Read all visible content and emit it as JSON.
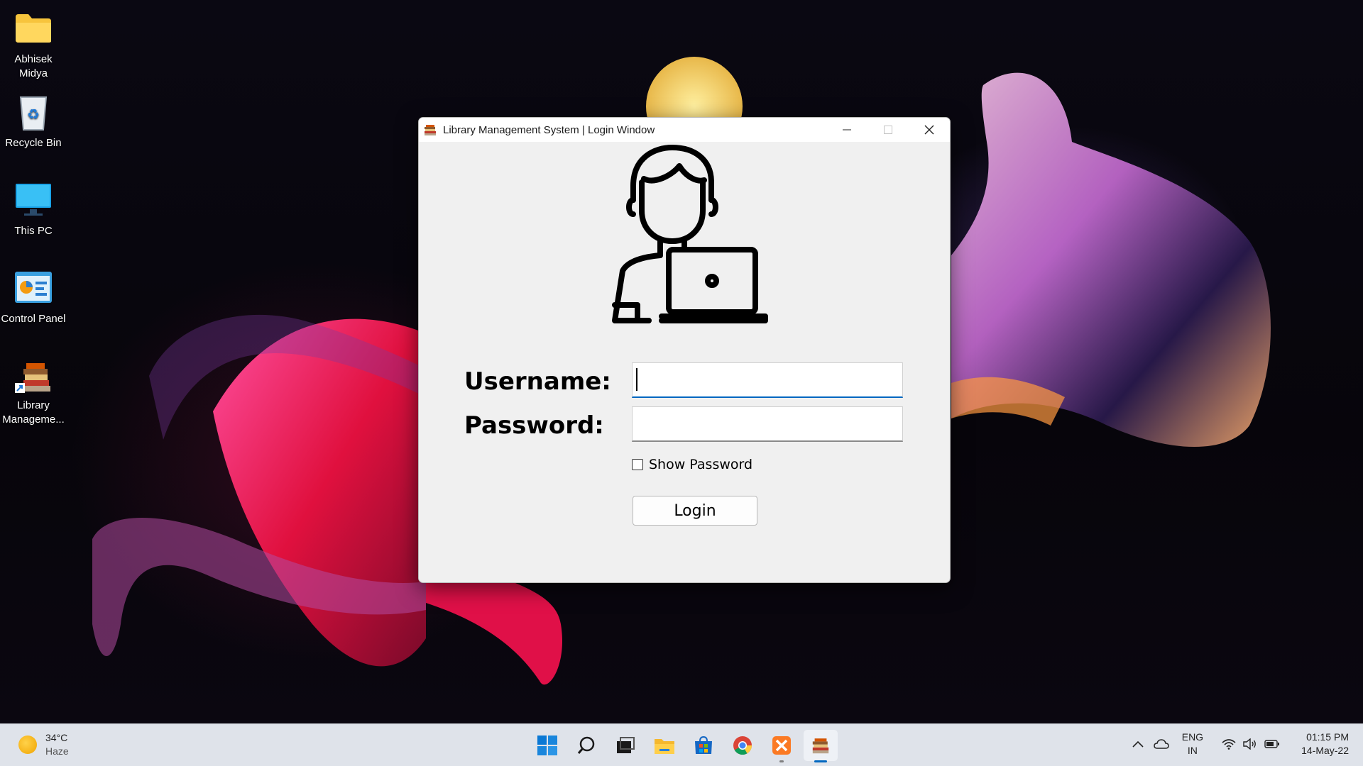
{
  "desktop": {
    "icons": [
      {
        "label": "Abhisek\nMidya",
        "icon": "folder-icon"
      },
      {
        "label": "Recycle Bin",
        "icon": "recycle-bin-icon"
      },
      {
        "label": "This PC",
        "icon": "monitor-icon"
      },
      {
        "label": "Control Panel",
        "icon": "control-panel-icon"
      },
      {
        "label": "Library\nManageme...",
        "icon": "library-shortcut-icon"
      }
    ]
  },
  "window": {
    "title": "Library Management System | Login Window",
    "username_label": "Username:",
    "password_label": "Password:",
    "username_value": "",
    "password_value": "",
    "show_password_label": "Show Password",
    "show_password_checked": false,
    "login_label": "Login"
  },
  "taskbar": {
    "weather": {
      "temp": "34°C",
      "condition": "Haze"
    },
    "apps": [
      "start-icon",
      "search-icon",
      "task-view-icon",
      "file-explorer-icon",
      "store-icon",
      "chrome-icon",
      "xampp-icon",
      "library-app-icon"
    ],
    "language": {
      "lang": "ENG",
      "region": "IN"
    },
    "clock": {
      "time": "01:15 PM",
      "date": "14-May-22"
    }
  }
}
